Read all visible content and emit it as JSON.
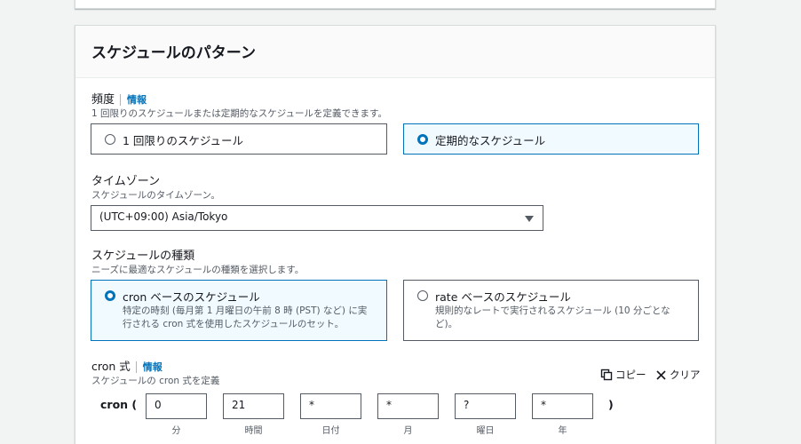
{
  "panel": {
    "title": "スケジュールのパターン"
  },
  "frequency": {
    "label": "頻度",
    "info": "情報",
    "description": "1 回限りのスケジュールまたは定期的なスケジュールを定義できます。",
    "options": [
      {
        "label": "1 回限りのスケジュール",
        "selected": false
      },
      {
        "label": "定期的なスケジュール",
        "selected": true
      }
    ]
  },
  "timezone": {
    "label": "タイムゾーン",
    "description": "スケジュールのタイムゾーン。",
    "value": "(UTC+09:00) Asia/Tokyo"
  },
  "schedule_type": {
    "label": "スケジュールの種類",
    "description": "ニーズに最適なスケジュールの種類を選択します。",
    "options": [
      {
        "label": "cron ベースのスケジュール",
        "desc_line1": "特定の時刻 (毎月第 1 月曜日の午前 8 時 (PST) など) に実",
        "desc_line2": "行される cron 式を使用したスケジュールのセット。",
        "selected": true
      },
      {
        "label": "rate ベースのスケジュール",
        "desc_line1": "規則的なレートで実行されるスケジュール (10 分ごとな",
        "desc_line2": "ど)。",
        "selected": false
      }
    ]
  },
  "cron": {
    "label": "cron 式",
    "info": "情報",
    "description": "スケジュールの cron 式を定義",
    "copy_label": "コピー",
    "clear_label": "クリア",
    "prefix": "cron (",
    "suffix": ")",
    "fields": [
      {
        "value": "0",
        "sub": "分"
      },
      {
        "value": "21",
        "sub": "時間"
      },
      {
        "value": "*",
        "sub": "日付"
      },
      {
        "value": "*",
        "sub": "月"
      },
      {
        "value": "?",
        "sub": "曜日"
      },
      {
        "value": "*",
        "sub": "年"
      }
    ]
  },
  "colors": {
    "accent": "#0073bb",
    "selected_bg": "#f1faff",
    "border": "#545b64"
  }
}
